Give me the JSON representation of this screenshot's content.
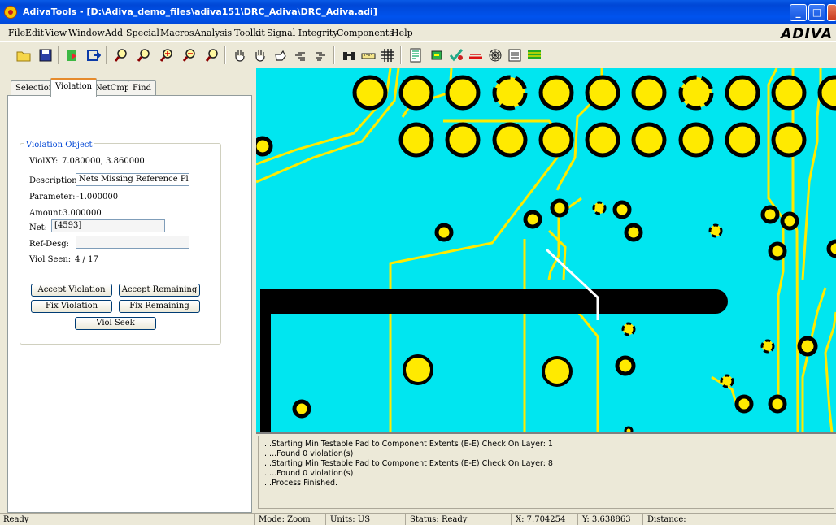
{
  "window": {
    "title": "AdivaTools - [D:\\Adiva_demo_files\\adiva151\\DRC_Adiva\\DRC_Adiva.adi]",
    "min_icon": "minimize-icon",
    "max_icon": "maximize-icon",
    "close_icon": "close-icon"
  },
  "menu": {
    "items": [
      "File",
      "Edit",
      "View",
      "Window",
      "Add",
      "Special",
      "Macros",
      "Analysis",
      "Toolkit",
      "Signal Integrity",
      "Components",
      "Help"
    ],
    "brand": "ADIVA"
  },
  "toolbar": {
    "icons": [
      "open-folder-icon",
      "save-icon",
      "import-icon",
      "export-icon",
      "zoom-window-icon",
      "zoom-all-icon",
      "zoom-in-icon",
      "zoom-out-icon",
      "zoom-previous-icon",
      "pan-hand-icon",
      "drag-hand-icon",
      "select-hand-icon",
      "point-hand-icon",
      "grab-hand-icon",
      "find-binoculars-icon",
      "measure-ruler-icon",
      "grid-icon",
      "report-icon",
      "component-icon",
      "check-icon",
      "route-icon",
      "net-web-icon",
      "notes-icon",
      "layers-icon"
    ]
  },
  "tabs": [
    "Selection",
    "Violation",
    "NetCmp",
    "Find"
  ],
  "active_tab": "Violation",
  "violation": {
    "group_title": "Violation Object",
    "viol_xy_label": "ViolXY:",
    "viol_xy": "7.080000, 3.860000",
    "description_label": "Description:",
    "description": "Nets Missing Reference Plane",
    "parameter_label": "Parameter:",
    "parameter": "-1.000000",
    "amount_label": "Amount:",
    "amount": "3.000000",
    "net_label": "Net:",
    "net": "[4593]",
    "refdesg_label": "Ref-Desg:",
    "refdesg": "",
    "viol_seen_label": "Viol Seen:",
    "viol_seen": "4 / 17",
    "buttons": {
      "accept_violation": "Accept Violation",
      "accept_remaining": "Accept Remaining",
      "fix_violation": "Fix Violation",
      "fix_remaining": "Fix Remaining",
      "viol_seek": "Viol Seek"
    }
  },
  "output": {
    "lines": [
      "....Starting Min Testable Pad to Component Extents (E-E) Check On Layer: 1",
      "......Found 0 violation(s)",
      "....Starting Min Testable Pad to Component Extents (E-E) Check On Layer: 8",
      "......Found 0 violation(s)",
      "....Process Finished."
    ]
  },
  "status": {
    "ready": "Ready",
    "mode": "Mode: Zoom",
    "units": "Units: US",
    "status": "Status: Ready",
    "x": "X: 7.704254",
    "y": "Y: 3.638863",
    "distance": "Distance:"
  },
  "colors": {
    "canvas_bg": "#00e6f0",
    "pad_fill": "#ffea00",
    "pad_ring": "#000000",
    "trace": "#ffea00",
    "plane_void": "#000000",
    "violation_marker": "#ffffff",
    "title_bar": "#0053ee"
  }
}
